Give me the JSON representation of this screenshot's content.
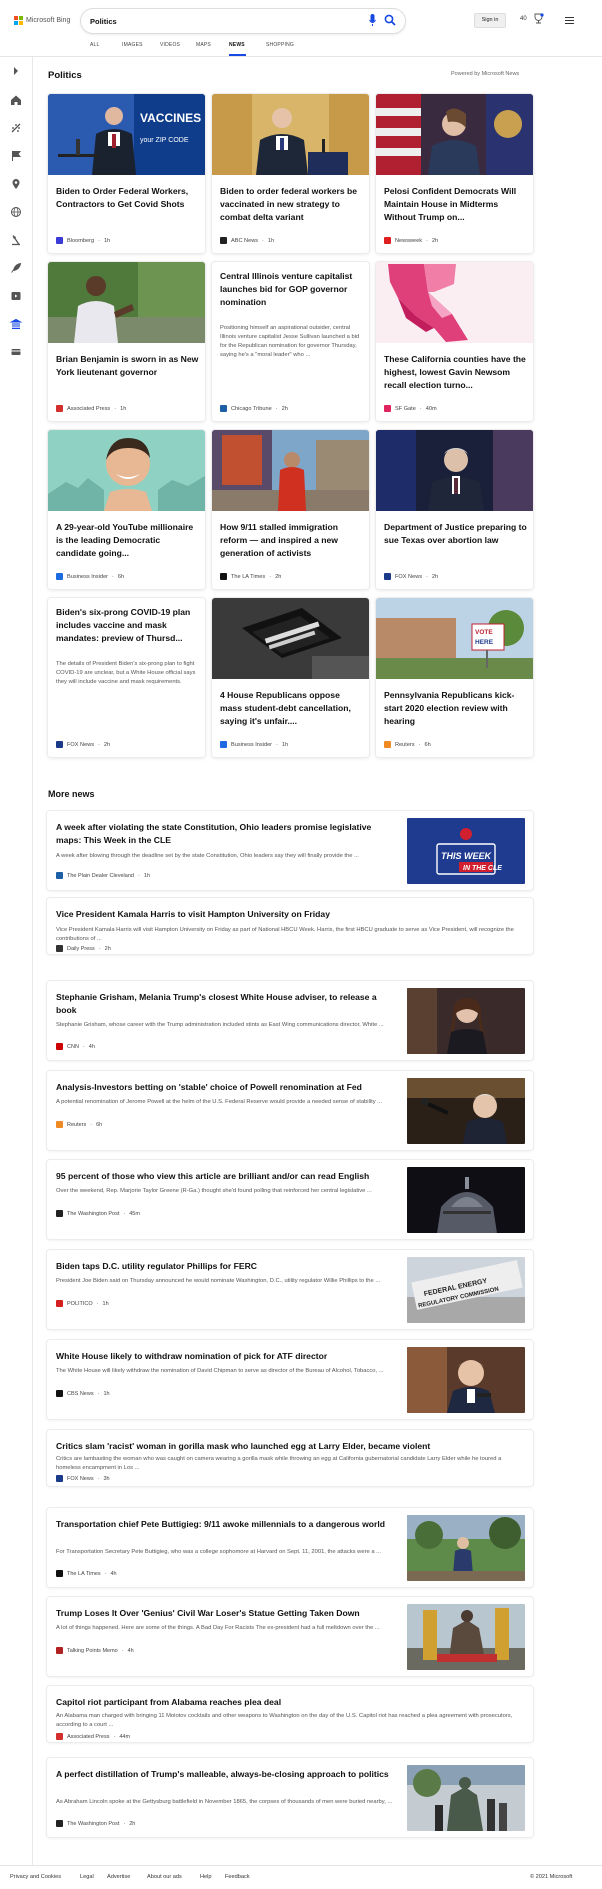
{
  "header": {
    "brand": "Microsoft Bing",
    "search_value": "Politics",
    "signin_label": "Sign in",
    "rewards_count": "40",
    "tabs": [
      {
        "label": "ALL"
      },
      {
        "label": "IMAGES"
      },
      {
        "label": "VIDEOS"
      },
      {
        "label": "MAPS"
      },
      {
        "label": "NEWS"
      },
      {
        "label": "SHOPPING"
      }
    ],
    "active_tab": "NEWS"
  },
  "sidebar": {
    "icons": [
      "expand-icon",
      "home-icon",
      "discover-icon",
      "flag-icon",
      "location-icon",
      "globe-icon",
      "science-icon",
      "rocket-icon",
      "entertainment-icon",
      "politics-icon",
      "money-icon"
    ]
  },
  "main": {
    "title": "Politics",
    "powered_by": "Powered by Microsoft News",
    "cards": [
      {
        "title": "Biden to Order Federal Workers, Contractors to Get Covid Shots",
        "source": "Bloomberg",
        "age": "1h",
        "image": "biden-vaccines-podium",
        "source_color": "#3b3bd6"
      },
      {
        "title": "Biden to order federal workers be vaccinated in new strategy to combat delta variant",
        "source": "ABC News",
        "age": "1h",
        "image": "biden-gold-curtain",
        "source_color": "#222222"
      },
      {
        "title": "Pelosi Confident Democrats Will Maintain House in Midterms Without Trump on...",
        "source": "Newsweek",
        "age": "2h",
        "image": "pelosi-flags",
        "source_color": "#e02020"
      },
      {
        "title": "Brian Benjamin is sworn in as New York lieutenant governor",
        "source": "Associated Press",
        "age": "1h",
        "image": "benjamin-outdoors",
        "source_color": "#d32f2f"
      },
      {
        "title": "Central Illinois venture capitalist launches bid for GOP governor nomination",
        "description": "Positioning himself an aspirational outsider, central Illinois venture capitalist Jesse Sullivan launched a bid for the Republican nomination for governor Thursday, saying he's a \"moral leader\" who ...",
        "source": "Chicago Tribune",
        "age": "2h",
        "image": "",
        "source_color": "#1f5fa8"
      },
      {
        "title": "These California counties have the highest, lowest Gavin Newsom recall election turno...",
        "source": "SF Gate",
        "age": "40m",
        "image": "california-map",
        "source_color": "#e0245e"
      },
      {
        "title": "A 29-year-old YouTube millionaire is the leading Democratic candidate going...",
        "source": "Business Insider",
        "age": "6h",
        "image": "smiling-man-teal",
        "source_color": "#1e6ae0"
      },
      {
        "title": "How 9/11 stalled immigration reform — and inspired a new generation of activists",
        "source": "The LA Times",
        "age": "2h",
        "image": "activist-mural",
        "source_color": "#111111"
      },
      {
        "title": "Department of Justice preparing to sue Texas over abortion law",
        "source": "FOX News",
        "age": "2h",
        "image": "garland-flags",
        "source_color": "#1a3a8a"
      },
      {
        "title": "Biden's six-prong COVID-19 plan includes vaccine and mask mandates: preview of Thursd...",
        "description": "The details of President Biden's six-prong plan to fight COVID-19 are unclear, but a White House official says they will include vaccine and mask requirements.",
        "source": "FOX News",
        "age": "2h",
        "image": "",
        "source_color": "#1a3a8a"
      },
      {
        "title": "4 House Republicans oppose mass student-debt cancellation, saying it's unfair....",
        "source": "Business Insider",
        "age": "1h",
        "image": "graduation-cap",
        "source_color": "#1e6ae0"
      },
      {
        "title": "Pennsylvania Republicans kick-start 2020 election review with hearing",
        "source": "Reuters",
        "age": "6h",
        "image": "vote-here-sign",
        "source_color": "#f08a24"
      }
    ]
  },
  "more_news": {
    "title": "More news",
    "items": [
      {
        "title": "A week after violating the state Constitution, Ohio leaders promise legislative maps: This Week in the CLE",
        "description": "A week after blowing through the deadline set by the state Constitution, Ohio leaders say they will finally provide the ...",
        "source": "The Plain Dealer Cleveland",
        "age": "1h",
        "has_image": true,
        "image": "this-week-cle",
        "image_text_1": "THIS WEEK",
        "image_text_2": "IN THE CLE",
        "source_color": "#1f5fa8"
      },
      {
        "title": "Vice President Kamala Harris to visit Hampton University on Friday",
        "description": "Vice President Kamala Harris will visit Hampton University on Friday as part of National HBCU Week. Harris, the first HBCU graduate to serve as Vice President, will recognize the contributions of ...",
        "source": "Daily Press",
        "age": "2h",
        "has_image": false,
        "source_color": "#333333"
      },
      {
        "title": "Stephanie Grisham, Melania Trump's closest White House adviser, to release a book",
        "description": "Stephanie Grisham, whose career with the Trump administration included stints as East Wing communications director, White ...",
        "source": "CNN",
        "age": "4h",
        "has_image": true,
        "image": "grisham-portrait",
        "source_color": "#cc0000"
      },
      {
        "title": "Analysis-Investors betting on 'stable' choice of Powell renomination at Fed",
        "description": "A potential renomination of Jerome Powell at the helm of the U.S. Federal Reserve would provide a needed sense of stability ...",
        "source": "Reuters",
        "age": "6h",
        "has_image": true,
        "image": "powell-mic",
        "source_color": "#f08a24"
      },
      {
        "title": "95 percent of those who view this article are brilliant and/or can read English",
        "description": "Over the weekend, Rep. Marjorie Taylor Greene (R-Ga.) thought she'd found polling that reinforced her central legislative ...",
        "source": "The Washington Post",
        "age": "45m",
        "has_image": true,
        "image": "capitol-dome",
        "source_color": "#222222"
      },
      {
        "title": "Biden taps D.C. utility regulator Phillips for FERC",
        "description": "President Joe Biden said on Thursday announced he would nominate Washington, D.C., utility regulator Willie Phillips to the ...",
        "source": "POLITICO",
        "age": "1h",
        "has_image": true,
        "image": "ferc-building",
        "image_text_1": "FEDERAL ENERGY",
        "image_text_2": "REGULATORY COMMISSION",
        "source_color": "#d42020"
      },
      {
        "title": "White House likely to withdraw nomination of pick for ATF director",
        "description": "The White House will likely withdraw the nomination of David Chipman to serve as director of the Bureau of Alcohol, Tobacco, ...",
        "source": "CBS News",
        "age": "1h",
        "has_image": true,
        "image": "chipman-portrait",
        "source_color": "#111111"
      },
      {
        "title": "Critics slam 'racist' woman in gorilla mask who launched egg at Larry Elder, became violent",
        "description": "Critics are lambasting the woman who was caught on camera wearing a gorilla mask while throwing an egg at California gubernatorial candidate Larry Elder while he toured a homeless encampment in Los ...",
        "source": "FOX News",
        "age": "3h",
        "has_image": false,
        "source_color": "#1a3a8a"
      },
      {
        "title": "Transportation chief Pete Buttigieg: 9/11 awoke millennials to a dangerous world",
        "description": "For Transportation Secretary Pete Buttigieg, who was a college sophomore at Harvard on Sept. 11, 2001, the attacks were a ...",
        "source": "The LA Times",
        "age": "4h",
        "has_image": true,
        "image": "buttigieg-outdoors",
        "source_color": "#111111"
      },
      {
        "title": "Trump Loses It Over 'Genius' Civil War Loser's Statue Getting Taken Down",
        "description": "A lot of things happened. Here are some of the things. A Bad Day For Racists The ex-president had a full meltdown over the ...",
        "source": "Talking Points Memo",
        "age": "4h",
        "has_image": true,
        "image": "statue-removal",
        "source_color": "#b22222"
      },
      {
        "title": "Capitol riot participant from Alabama reaches plea deal",
        "description": "An Alabama man charged with bringing 11 Molotov cocktails and other weapons to Washington on the day of the U.S. Capitol riot has reached a plea agreement with prosecutors, according to a court ...",
        "source": "Associated Press",
        "age": "44m",
        "has_image": false,
        "source_color": "#d32f2f"
      },
      {
        "title": "A perfect distillation of Trump's malleable, always-be-closing approach to politics",
        "description": "As Abraham Lincoln spoke at the Gettysburg battlefield in November 1865, the corpses of thousands of men were buried nearby, ...",
        "source": "The Washington Post",
        "age": "2h",
        "has_image": true,
        "image": "statue-crowd",
        "source_color": "#222222"
      }
    ]
  },
  "footer": {
    "links": [
      "Privacy and Cookies",
      "Legal",
      "Advertise",
      "About our ads",
      "Help",
      "Feedback"
    ],
    "copyright": "© 2021 Microsoft"
  }
}
